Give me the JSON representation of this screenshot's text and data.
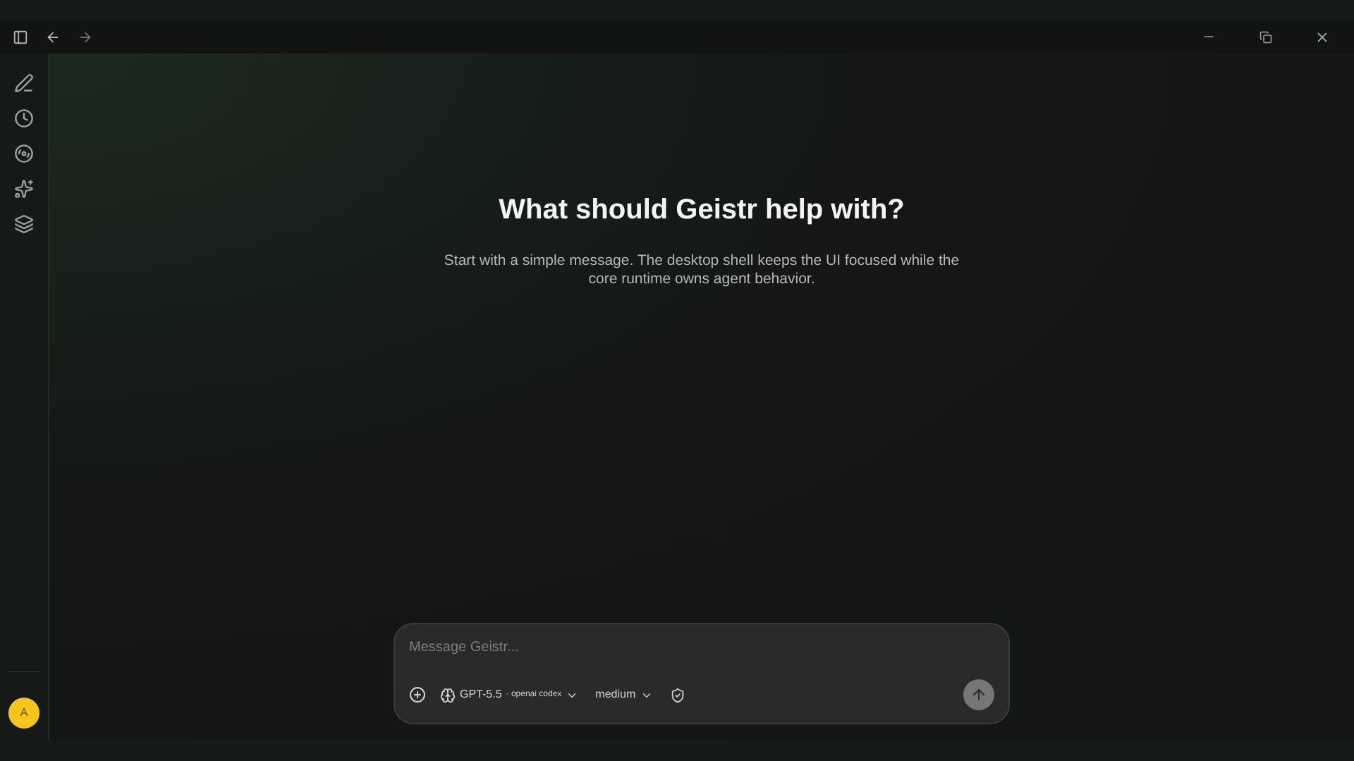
{
  "user": {
    "initial": "A"
  },
  "hero": {
    "title": "What should Geistr help with?",
    "subtitle": "Start with a simple message. The desktop shell keeps the UI focused while the core runtime owns agent behavior."
  },
  "composer": {
    "placeholder": "Message Geistr...",
    "model": "GPT-5.5",
    "provider": "· openai codex",
    "effort": "medium"
  }
}
